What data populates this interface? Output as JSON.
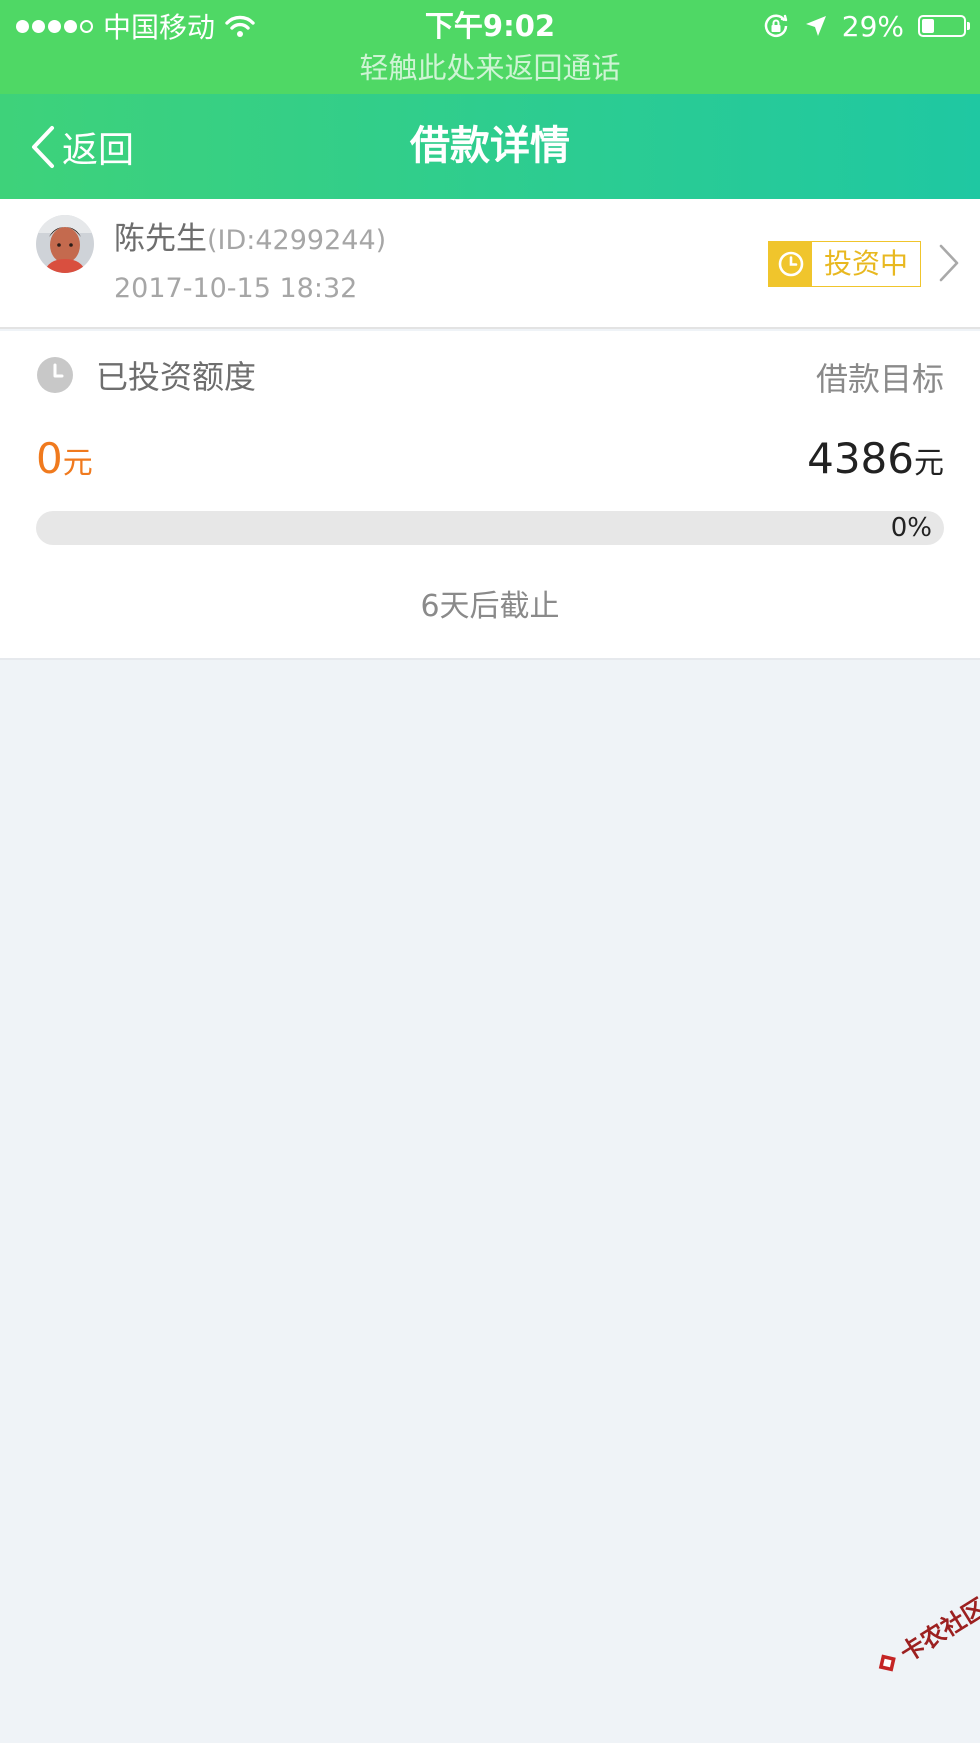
{
  "status_bar": {
    "carrier": "中国移动",
    "time": "下午9:02",
    "battery_percent": "29%",
    "battery_level": 0.29,
    "call_banner": "轻触此处来返回通话"
  },
  "nav": {
    "back_label": "返回",
    "title": "借款详情"
  },
  "user": {
    "name": "陈先生",
    "id_text": "(ID:4299244)",
    "date": "2017-10-15 18:32",
    "status_badge": "投资中"
  },
  "funding": {
    "invested_label": "已投资额度",
    "target_label": "借款目标",
    "invested_amount": "0",
    "invested_unit": "元",
    "target_amount": "4386",
    "target_unit": "元",
    "progress_text": "0%",
    "progress_fraction": 0,
    "deadline": "6天后截止"
  },
  "watermark": {
    "text": "卡农社区"
  },
  "colors": {
    "status_bar_green": "#4fd865",
    "nav_gradient_start": "#3ed27a",
    "nav_gradient_end": "#1fc8a2",
    "accent_orange": "#f07a1e",
    "badge_yellow": "#f0c52c",
    "page_background": "#eff3f7"
  },
  "icons": {
    "back": "chevron-left-icon",
    "badge": "clock-icon",
    "invested": "clock-icon",
    "detail": "chevron-right-icon",
    "wifi": "wifi-icon",
    "orientation_lock": "orientation-lock-icon",
    "location": "location-arrow-icon",
    "battery": "battery-icon"
  }
}
